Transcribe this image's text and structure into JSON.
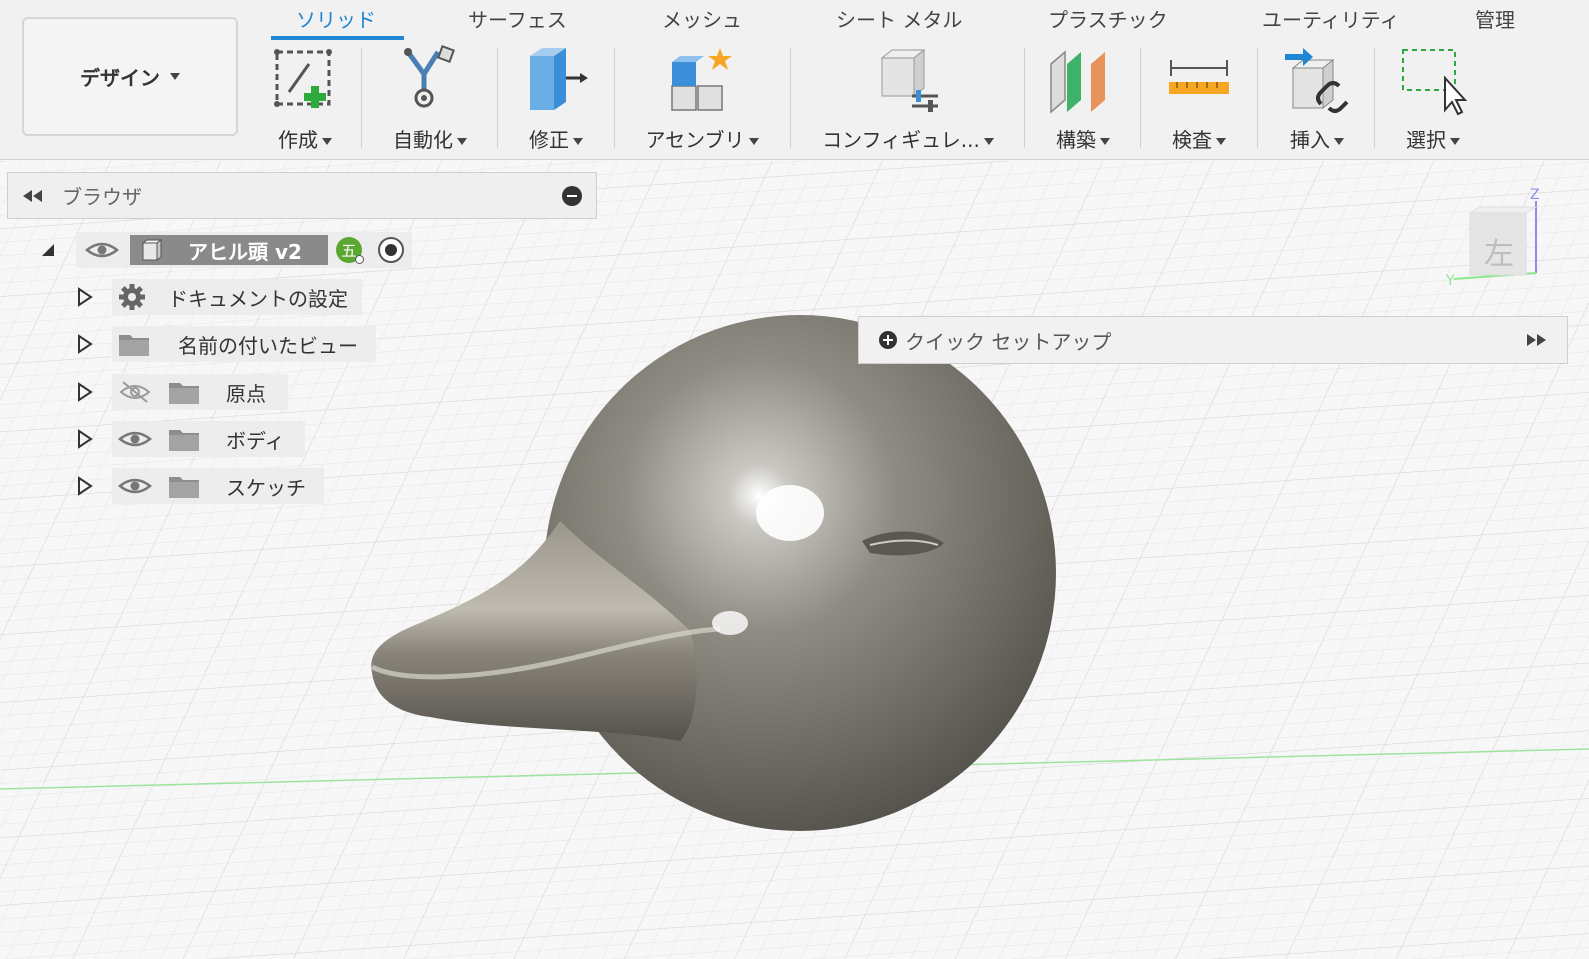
{
  "toolbar": {
    "workspace": "デザイン",
    "tabs": [
      "ソリッド",
      "サーフェス",
      "メッシュ",
      "シート メタル",
      "プラスチック",
      "ユーティリティ",
      "管理"
    ],
    "active_tab": "ソリッド",
    "tools": [
      {
        "label": "作成",
        "icon": "create-sketch-icon"
      },
      {
        "label": "自動化",
        "icon": "automate-icon"
      },
      {
        "label": "修正",
        "icon": "modify-icon"
      },
      {
        "label": "アセンブリ",
        "icon": "assembly-icon"
      },
      {
        "label": "コンフィギュレ...",
        "icon": "configure-icon"
      },
      {
        "label": "構築",
        "icon": "construct-icon"
      },
      {
        "label": "検査",
        "icon": "inspect-icon"
      },
      {
        "label": "挿入",
        "icon": "insert-icon"
      },
      {
        "label": "選択",
        "icon": "select-icon"
      }
    ]
  },
  "browser": {
    "title": "ブラウザ",
    "root": {
      "label": "アヒル頭 v2",
      "badge": "五"
    },
    "items": [
      {
        "label": "ドキュメントの設定",
        "icon": "gear-icon",
        "visibility": "none"
      },
      {
        "label": "名前の付いたビュー",
        "icon": "folder-icon",
        "visibility": "none"
      },
      {
        "label": "原点",
        "icon": "folder-icon",
        "visibility": "hidden"
      },
      {
        "label": "ボディ",
        "icon": "folder-icon",
        "visibility": "visible"
      },
      {
        "label": "スケッチ",
        "icon": "folder-icon",
        "visibility": "visible"
      }
    ]
  },
  "quick_setup": {
    "title": "クイック セットアップ"
  },
  "viewcube": {
    "face": "左",
    "axis_z": "Z",
    "axis_y": "Y"
  },
  "colors": {
    "accent": "#1e86d3",
    "model": "#77736b"
  }
}
